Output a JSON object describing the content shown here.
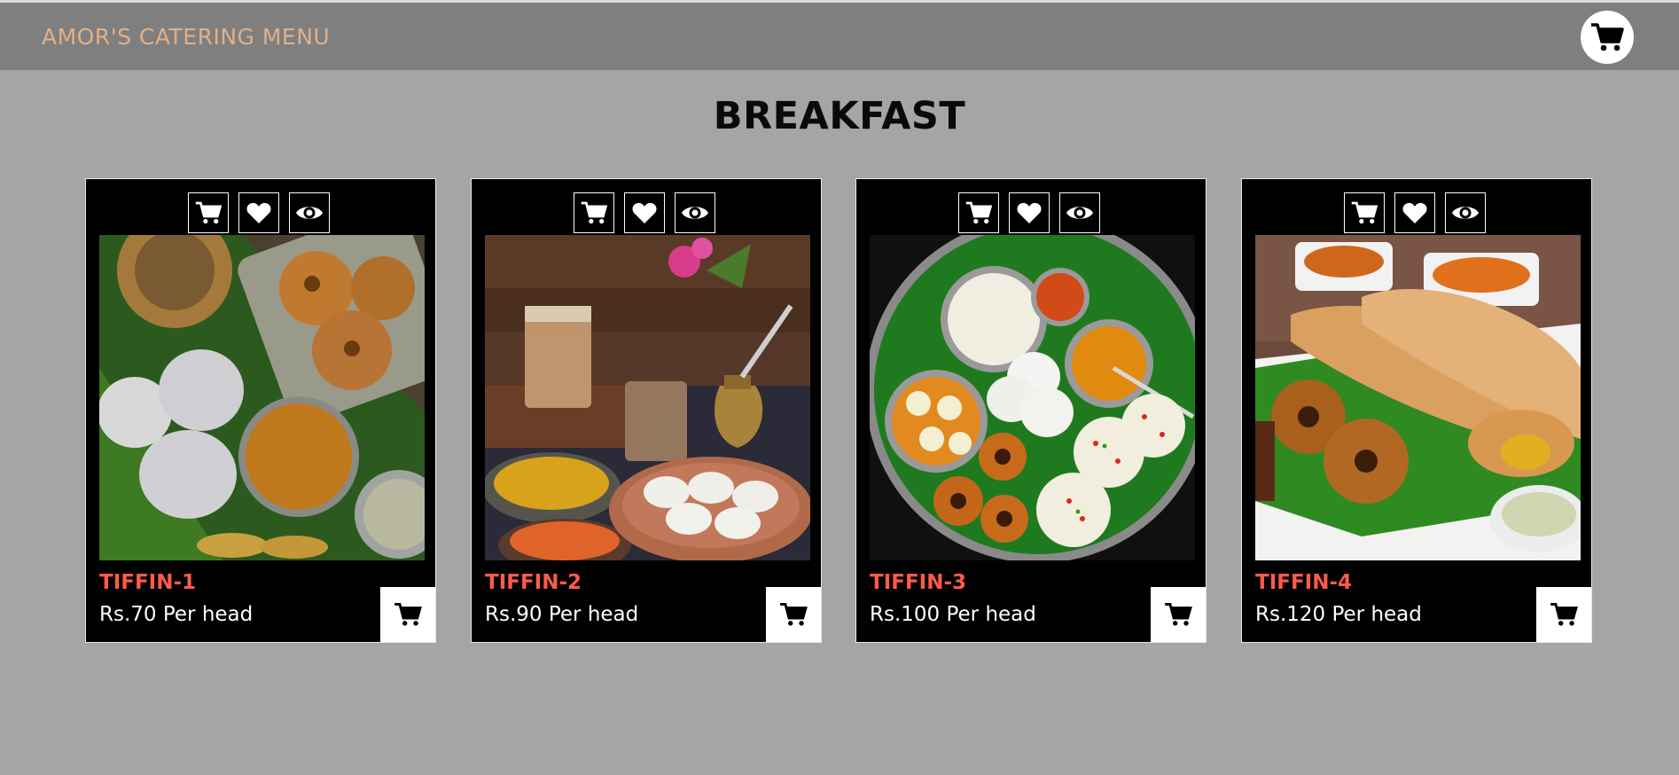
{
  "header": {
    "brand": "AMOR'S CATERING MENU",
    "cart_icon": "cart-icon"
  },
  "page": {
    "title": "BREAKFAST"
  },
  "colors": {
    "background": "#a5a5a5",
    "header": "#7f7f7f",
    "brand": "#e0b089",
    "item_name": "#ff5a4a",
    "card": "#000000"
  },
  "card_actions": [
    "cart-icon",
    "heart-icon",
    "eye-icon"
  ],
  "items": [
    {
      "name": "TIFFIN-1",
      "price": "Rs.70 Per head"
    },
    {
      "name": "TIFFIN-2",
      "price": "Rs.90 Per head"
    },
    {
      "name": "TIFFIN-3",
      "price": "Rs.100 Per head"
    },
    {
      "name": "TIFFIN-4",
      "price": "Rs.120 Per head"
    }
  ]
}
